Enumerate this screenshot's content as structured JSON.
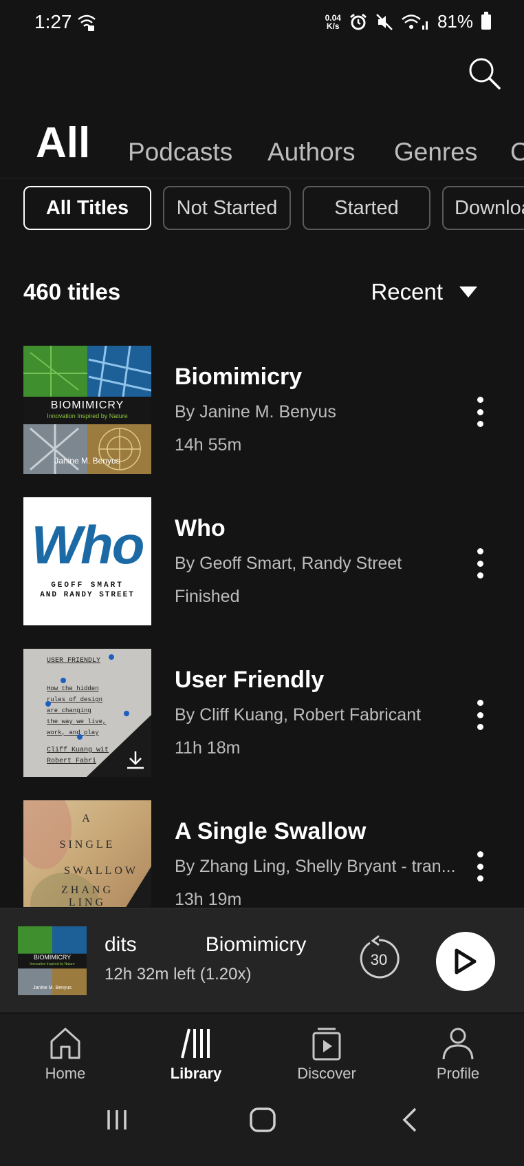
{
  "status": {
    "time": "1:27",
    "net_speed_value": "0.04",
    "net_speed_unit": "K/s",
    "battery": "81%"
  },
  "tabs": [
    "All",
    "Podcasts",
    "Authors",
    "Genres",
    "C"
  ],
  "filters": [
    "All Titles",
    "Not Started",
    "Started",
    "Downloa"
  ],
  "list_header": {
    "count": "460 titles",
    "sort": "Recent"
  },
  "books": [
    {
      "title": "Biomimicry",
      "author": "By Janine M. Benyus",
      "meta": "14h 55m",
      "cover": {
        "title": "BIOMIMICRY",
        "subtitle": "Innovation Inspired by Nature",
        "author": "Janine M. Benyus"
      }
    },
    {
      "title": "Who",
      "author": "By Geoff Smart, Randy Street",
      "meta": "Finished",
      "cover": {
        "title": "Who",
        "line1": "GEOFF SMART",
        "line2": "AND RANDY STREET"
      }
    },
    {
      "title": "User Friendly",
      "author": "By Cliff Kuang, Robert Fabricant",
      "meta": "11h 18m",
      "cover": {
        "heading": "USER FRIENDLY",
        "lines": [
          "How the hidden",
          "rules of design",
          "are changing",
          "the way we live,",
          "work, and play"
        ],
        "authors": [
          "Cliff Kuang wit",
          "Robert Fabri"
        ]
      }
    },
    {
      "title": "A Single Swallow",
      "author": "By Zhang Ling, Shelly Bryant - tran...",
      "meta": "13h 19m",
      "cover": {
        "words": [
          "A",
          "SINGLE",
          "SWALLOW",
          "ZHANG",
          "LING"
        ]
      }
    }
  ],
  "player": {
    "marquee": "dits            Biomimicry  |",
    "time_left": "12h 32m left (1.20x)",
    "rewind": "30",
    "cover": {
      "title": "BIOMIMICRY",
      "subtitle": "Innovation Inspired by Nature",
      "author": "Janine M. Benyus"
    }
  },
  "nav": [
    "Home",
    "Library",
    "Discover",
    "Profile"
  ]
}
